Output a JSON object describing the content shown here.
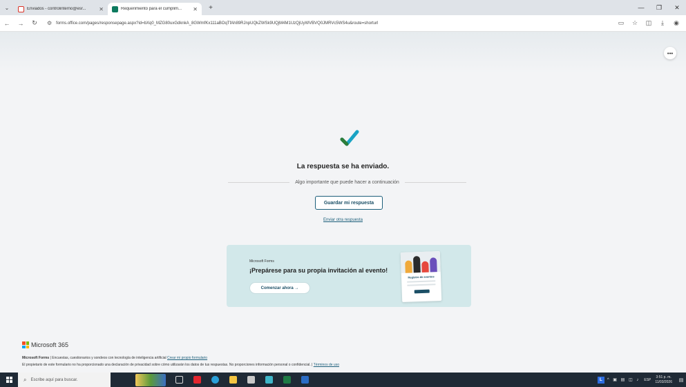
{
  "browser": {
    "tabs": [
      {
        "title": "Enviados - controlinterno@esr...",
        "favicon": "gmail-icon",
        "active": false
      },
      {
        "title": "Requerimiento para el cumplim...",
        "favicon": "forms-icon",
        "active": true
      }
    ],
    "url": "forms.office.com/pages/responsepage.aspx?id=bXq0_MZG80uxGdknkA_8GWmfKx111aBOqTfAh89RJnpUQkZWSk9UQjM4M1UzQjUyWVBVQ0JMRVc5WS4u&route=shorturl"
  },
  "confirmation": {
    "title": "La respuesta se ha enviado.",
    "subtitle": "Algo importante que puede hacer a continuación",
    "save_label": "Guardar mi respuesta",
    "another_link": "Enviar otra respuesta"
  },
  "promo": {
    "brand": "Microsoft Forms",
    "heading": "¡Prepárese para su propia invitación al evento!",
    "cta_label": "Comenzar ahora →",
    "card_title": "Registro de eventos"
  },
  "footer": {
    "logo_text": "Microsoft 365",
    "line1_brand": "Microsoft Forms",
    "line1_text": " | Encuestas, cuestionarios y sondeos con tecnología de inteligencia artificial ",
    "line1_link": "Crear mi propio formulario",
    "line2_text": "El propietario de este formulario no ha proporcionado una declaración de privacidad sobre cómo utilizarán los datos de tus respuestas. No proporciones información personal o confidencial. | ",
    "line2_link": "Términos de uso"
  },
  "taskbar": {
    "search_placeholder": "Escribe aquí para buscar.",
    "lang": "ESP",
    "time": "3:51 p. m.",
    "date": "11/03/2026"
  },
  "colors": {
    "accent": "#1b5e7a",
    "promo_bg": "#d2e8ea",
    "taskbar": "#1f2a36"
  }
}
